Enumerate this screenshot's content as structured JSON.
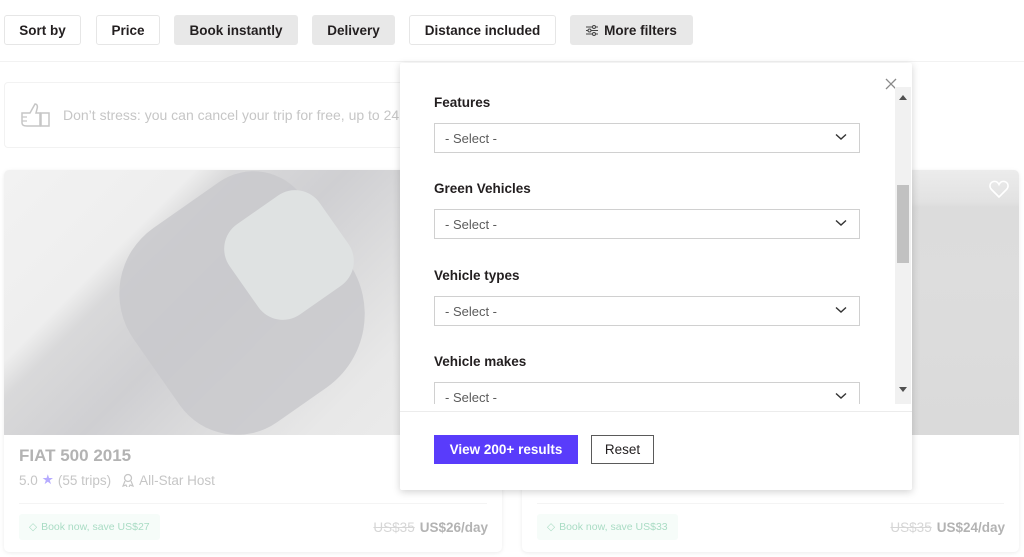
{
  "filters": {
    "chips": [
      {
        "label": "Sort by",
        "style": "outline"
      },
      {
        "label": "Price",
        "style": "outline"
      },
      {
        "label": "Book instantly",
        "style": "filled"
      },
      {
        "label": "Delivery",
        "style": "filled"
      },
      {
        "label": "Distance included",
        "style": "outline"
      },
      {
        "label": "More filters",
        "style": "filled",
        "icon": "sliders-icon"
      }
    ]
  },
  "notice": {
    "icon": "thumbs-up-icon",
    "text": "Don’t stress: you can cancel your trip for free, up to 24"
  },
  "listings": [
    {
      "title": "FIAT 500 2015",
      "rating": "5.0",
      "trips": "(55 trips)",
      "host_badge": "All-Star Host",
      "promo": "Book now, save US$27",
      "old_price": "US$35",
      "price": "US$26/day"
    },
    {
      "promo": "Book now, save US$33",
      "old_price": "US$35",
      "price": "US$24/day"
    }
  ],
  "modal": {
    "groups": [
      {
        "label": "Features",
        "value": "- Select -"
      },
      {
        "label": "Green Vehicles",
        "value": "- Select -"
      },
      {
        "label": "Vehicle types",
        "value": "- Select -"
      },
      {
        "label": "Vehicle makes",
        "value": "- Select -"
      }
    ],
    "primary_button": "View 200+ results",
    "reset_button": "Reset"
  },
  "colors": {
    "accent": "#593cfb",
    "star": "#b6abff",
    "promo_text": "#a9dcc4"
  }
}
